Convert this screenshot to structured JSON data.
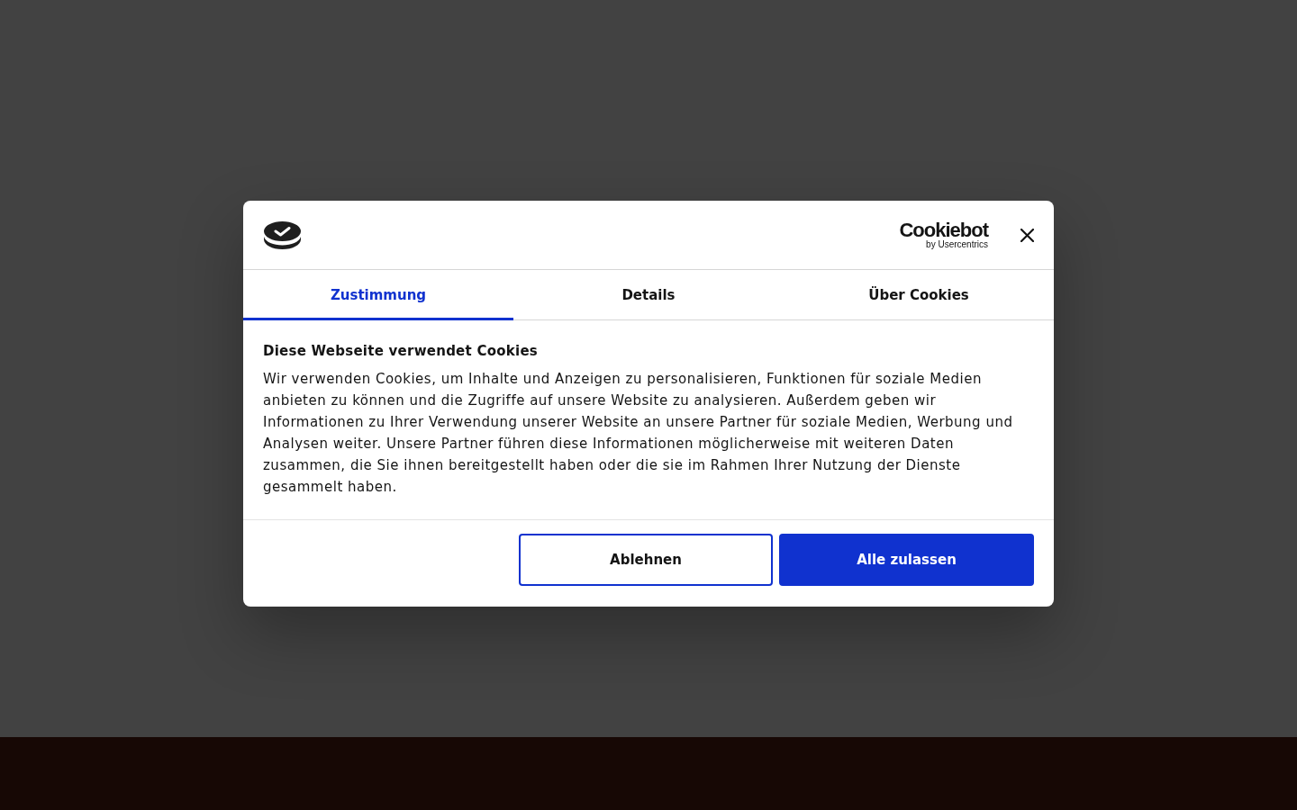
{
  "dialog": {
    "header": {
      "brand_name": "Cookiebot",
      "brand_byline": "by Usercentrics"
    },
    "tabs": [
      {
        "label": "Zustimmung",
        "selected": true
      },
      {
        "label": "Details",
        "selected": false
      },
      {
        "label": "Über Cookies",
        "selected": false
      }
    ],
    "title": "Diese Webseite verwendet Cookies",
    "body": "Wir verwenden Cookies, um Inhalte und Anzeigen zu personalisieren, Funktionen für soziale Medien anbieten zu können und die Zugriffe auf unsere Website zu analysieren. Außerdem geben wir Informationen zu Ihrer Verwendung unserer Website an unsere Partner für soziale Medien, Werbung und Analysen weiter. Unsere Partner führen diese Informationen möglicherweise mit weiteren Daten zusammen, die Sie ihnen bereitgestellt haben oder die sie im Rahmen Ihrer Nutzung der Dienste gesammelt haben.",
    "buttons": [
      {
        "label": "Ablehnen",
        "kind": "outline"
      },
      {
        "label": "Alle zulassen",
        "kind": "primary"
      }
    ]
  }
}
